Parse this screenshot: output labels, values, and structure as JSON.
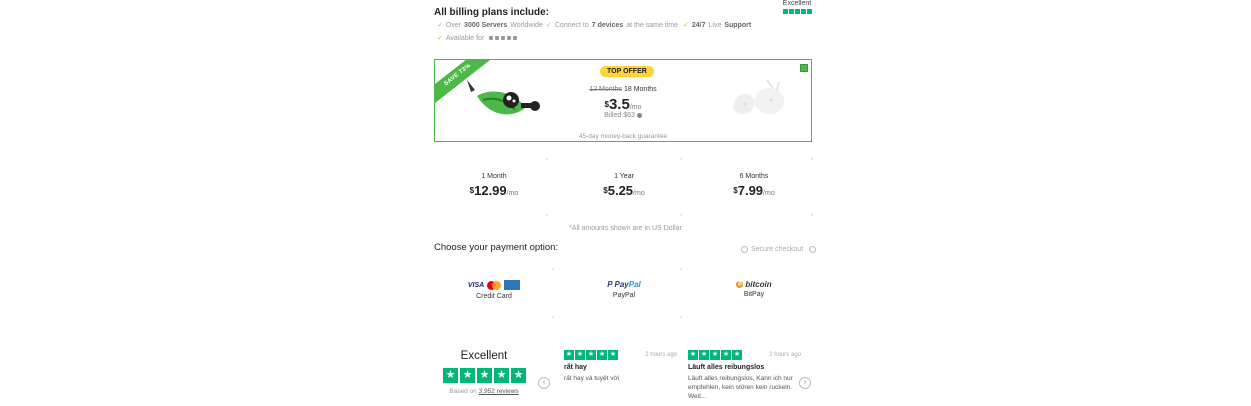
{
  "trust_top": {
    "label": "Excellent"
  },
  "includes": {
    "title": "All billing plans include:",
    "f1_pre": "Over",
    "f1_bold": "3000 Servers",
    "f1_post": "Worldwide",
    "f2_pre": "Connect to",
    "f2_bold": "7 devices",
    "f2_post": "at the same time",
    "f3_bold": "24/7",
    "f3_mid": "Live",
    "f3_bold2": "Support",
    "f4": "Available for"
  },
  "offer": {
    "ribbon": "SAVE 73%",
    "badge": "TOP OFFER",
    "term_old": "12 Months",
    "term_new": "18 Months",
    "currency": "$",
    "price": "3.5",
    "unit": "/mo",
    "billed": "Billed $63",
    "guarantee": "45-day money-back guarantee"
  },
  "plans": [
    {
      "term": "1 Month",
      "currency": "$",
      "price": "12.99",
      "unit": "/mo"
    },
    {
      "term": "1 Year",
      "currency": "$",
      "price": "5.25",
      "unit": "/mo"
    },
    {
      "term": "6 Months",
      "currency": "$",
      "price": "7.99",
      "unit": "/mo"
    }
  ],
  "note": "*All amounts shown are in US Dollar",
  "payment": {
    "title": "Choose your payment option:",
    "secure": "Secure checkout",
    "options": [
      {
        "label": "Credit Card",
        "logo": "VISA"
      },
      {
        "label": "PayPal",
        "logo_a": "Pay",
        "logo_b": "Pal"
      },
      {
        "label": "BitPay",
        "logo": "bitcoin"
      }
    ]
  },
  "reviews": {
    "summary": "Excellent",
    "based_pre": "Based on",
    "based_link": "3,952 reviews",
    "items": [
      {
        "ago": "2 hours ago",
        "title": "rất hay",
        "body": "rất hay và tuyệt vời"
      },
      {
        "ago": "2 hours ago",
        "title": "Läuft alles reibungslos",
        "body": "Läuft alles reibungslos, Kann ich nur empfehlen, kein stören kein ruckeln. Weit..."
      }
    ]
  },
  "colors": {
    "accent": "#4cb848",
    "badge": "#ffd33a",
    "trustpilot": "#00b67a"
  }
}
